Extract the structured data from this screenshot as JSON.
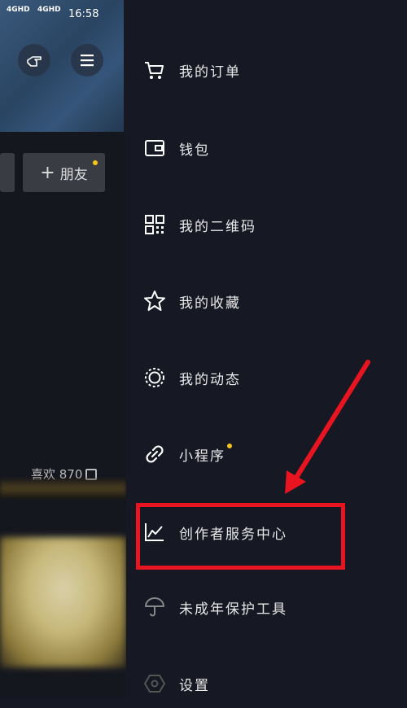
{
  "status_bar": {
    "signal1": "4GHD",
    "signal2": "4GHD",
    "time": "16:58"
  },
  "background_page": {
    "add_friend_label": "朋友",
    "likes_label": "喜欢 870"
  },
  "drawer": {
    "items": [
      {
        "label": "我的订单",
        "icon": "cart-icon"
      },
      {
        "label": "钱包",
        "icon": "wallet-icon"
      },
      {
        "label": "我的二维码",
        "icon": "qr-code-icon"
      },
      {
        "label": "我的收藏",
        "icon": "star-icon"
      },
      {
        "label": "我的动态",
        "icon": "activity-circle-icon"
      },
      {
        "label": "小程序",
        "icon": "link-icon"
      },
      {
        "label": "创作者服务中心",
        "icon": "chart-line-icon"
      },
      {
        "label": "未成年保护工具",
        "icon": "umbrella-icon"
      },
      {
        "label": "设置",
        "icon": "settings-hexagon-icon"
      }
    ]
  },
  "colors": {
    "drawer_bg": "#161823",
    "highlight": "#e8141f",
    "badge": "#f5c518"
  }
}
